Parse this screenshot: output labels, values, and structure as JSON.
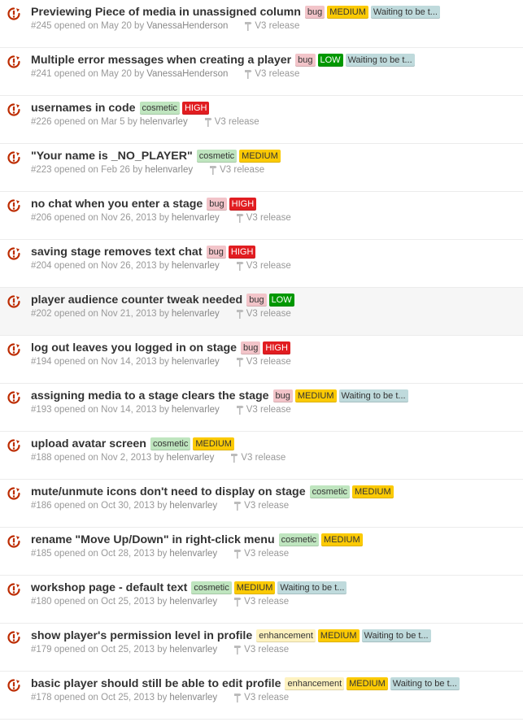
{
  "colors": {
    "bug": {
      "bg": "#f2c4c9",
      "fg": "#333333"
    },
    "cosmetic": {
      "bg": "#bfe5bf",
      "fg": "#333333"
    },
    "enhancement": {
      "bg": "#fef2c0",
      "fg": "#333333"
    },
    "HIGH": {
      "bg": "#e11d21",
      "fg": "#ffffff"
    },
    "MEDIUM": {
      "bg": "#fbca04",
      "fg": "#333333"
    },
    "LOW": {
      "bg": "#009800",
      "fg": "#ffffff"
    },
    "waiting": {
      "bg": "#bfdadc",
      "fg": "#333333"
    },
    "issue_icon": "#bd2c00"
  },
  "issues": [
    {
      "title": "Previewing Piece of media in unassigned column",
      "labels": [
        {
          "text": "bug",
          "kind": "bug"
        },
        {
          "text": "MEDIUM",
          "kind": "MEDIUM"
        },
        {
          "text": "Waiting to be t...",
          "kind": "waiting"
        }
      ],
      "number": "#245",
      "opened": "opened on May 20 by",
      "author": "VanessaHenderson",
      "milestone": "V3 release"
    },
    {
      "title": "Multiple error messages when creating a player",
      "labels": [
        {
          "text": "bug",
          "kind": "bug"
        },
        {
          "text": "LOW",
          "kind": "LOW"
        },
        {
          "text": "Waiting to be t...",
          "kind": "waiting"
        }
      ],
      "number": "#241",
      "opened": "opened on May 20 by",
      "author": "VanessaHenderson",
      "milestone": "V3 release"
    },
    {
      "title": "usernames in code",
      "labels": [
        {
          "text": "cosmetic",
          "kind": "cosmetic"
        },
        {
          "text": "HIGH",
          "kind": "HIGH"
        }
      ],
      "number": "#226",
      "opened": "opened on Mar 5 by",
      "author": "helenvarley",
      "milestone": "V3 release"
    },
    {
      "title": "\"Your name is _NO_PLAYER\"",
      "labels": [
        {
          "text": "cosmetic",
          "kind": "cosmetic"
        },
        {
          "text": "MEDIUM",
          "kind": "MEDIUM"
        }
      ],
      "number": "#223",
      "opened": "opened on Feb 26 by",
      "author": "helenvarley",
      "milestone": "V3 release"
    },
    {
      "title": "no chat when you enter a stage",
      "labels": [
        {
          "text": "bug",
          "kind": "bug"
        },
        {
          "text": "HIGH",
          "kind": "HIGH"
        }
      ],
      "number": "#206",
      "opened": "opened on Nov 26, 2013 by",
      "author": "helenvarley",
      "milestone": "V3 release"
    },
    {
      "title": "saving stage removes text chat",
      "labels": [
        {
          "text": "bug",
          "kind": "bug"
        },
        {
          "text": "HIGH",
          "kind": "HIGH"
        }
      ],
      "number": "#204",
      "opened": "opened on Nov 26, 2013 by",
      "author": "helenvarley",
      "milestone": "V3 release"
    },
    {
      "title": "player audience counter tweak needed",
      "labels": [
        {
          "text": "bug",
          "kind": "bug"
        },
        {
          "text": "LOW",
          "kind": "LOW"
        }
      ],
      "number": "#202",
      "opened": "opened on Nov 21, 2013 by",
      "author": "helenvarley",
      "milestone": "V3 release"
    },
    {
      "title": "log out leaves you logged in on stage",
      "labels": [
        {
          "text": "bug",
          "kind": "bug"
        },
        {
          "text": "HIGH",
          "kind": "HIGH"
        }
      ],
      "number": "#194",
      "opened": "opened on Nov 14, 2013 by",
      "author": "helenvarley",
      "milestone": "V3 release"
    },
    {
      "title": "assigning media to a stage clears the stage",
      "labels": [
        {
          "text": "bug",
          "kind": "bug"
        },
        {
          "text": "MEDIUM",
          "kind": "MEDIUM"
        },
        {
          "text": "Waiting to be t...",
          "kind": "waiting"
        }
      ],
      "number": "#193",
      "opened": "opened on Nov 14, 2013 by",
      "author": "helenvarley",
      "milestone": "V3 release"
    },
    {
      "title": "upload avatar screen",
      "labels": [
        {
          "text": "cosmetic",
          "kind": "cosmetic"
        },
        {
          "text": "MEDIUM",
          "kind": "MEDIUM"
        }
      ],
      "number": "#188",
      "opened": "opened on Nov 2, 2013 by",
      "author": "helenvarley",
      "milestone": "V3 release"
    },
    {
      "title": "mute/unmute icons don't need to display on stage",
      "labels": [
        {
          "text": "cosmetic",
          "kind": "cosmetic"
        },
        {
          "text": "MEDIUM",
          "kind": "MEDIUM"
        }
      ],
      "number": "#186",
      "opened": "opened on Oct 30, 2013 by",
      "author": "helenvarley",
      "milestone": "V3 release"
    },
    {
      "title": "rename \"Move Up/Down\" in right-click menu",
      "labels": [
        {
          "text": "cosmetic",
          "kind": "cosmetic"
        },
        {
          "text": "MEDIUM",
          "kind": "MEDIUM"
        }
      ],
      "number": "#185",
      "opened": "opened on Oct 28, 2013 by",
      "author": "helenvarley",
      "milestone": "V3 release"
    },
    {
      "title": "workshop page - default text",
      "labels": [
        {
          "text": "cosmetic",
          "kind": "cosmetic"
        },
        {
          "text": "MEDIUM",
          "kind": "MEDIUM"
        },
        {
          "text": "Waiting to be t...",
          "kind": "waiting"
        }
      ],
      "number": "#180",
      "opened": "opened on Oct 25, 2013 by",
      "author": "helenvarley",
      "milestone": "V3 release"
    },
    {
      "title": "show player's permission level in profile",
      "labels": [
        {
          "text": "enhancement",
          "kind": "enhancement"
        },
        {
          "text": "MEDIUM",
          "kind": "MEDIUM"
        },
        {
          "text": "Waiting to be t...",
          "kind": "waiting"
        }
      ],
      "number": "#179",
      "opened": "opened on Oct 25, 2013 by",
      "author": "helenvarley",
      "milestone": "V3 release"
    },
    {
      "title": "basic player should still be able to edit profile",
      "labels": [
        {
          "text": "enhancement",
          "kind": "enhancement"
        },
        {
          "text": "MEDIUM",
          "kind": "MEDIUM"
        },
        {
          "text": "Waiting to be t...",
          "kind": "waiting"
        }
      ],
      "number": "#178",
      "opened": "opened on Oct 25, 2013 by",
      "author": "helenvarley",
      "milestone": "V3 release"
    }
  ]
}
